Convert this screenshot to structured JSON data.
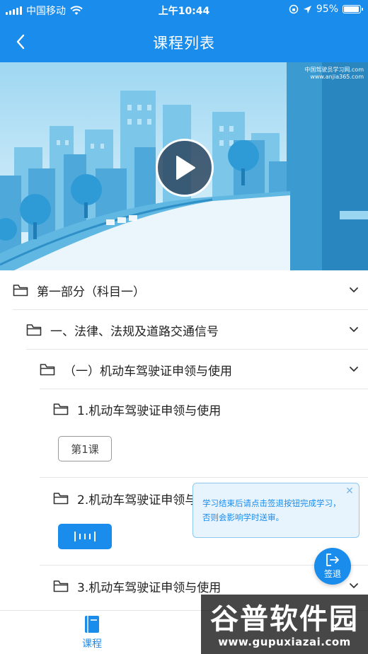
{
  "status_bar": {
    "carrier": "中国移动",
    "time": "上午10:44",
    "battery": "95%",
    "battery_level": 0.95
  },
  "nav": {
    "title": "课程列表",
    "back_icon": "chevron-left-icon"
  },
  "video": {
    "watermark_line1": "中国驾驶员学习网.com",
    "watermark_line2": "www.anjia365.com",
    "play_icon": "play-icon"
  },
  "tree": {
    "part": "第一部分（科目一）",
    "chapter": "一、法律、法规及道路交通信号",
    "section": "（一）机动车驾驶证申领与使用",
    "items": [
      {
        "title": "1.机动车驾驶证申领与使用",
        "button": "第1课"
      },
      {
        "title": "2.机动车驾驶证申领与使用",
        "button_icon": "audio-wave-icon"
      },
      {
        "title": "3.机动车驾驶证申领与使用"
      }
    ]
  },
  "tooltip": {
    "line1": "学习结束后请点击签退按钮完成学习，",
    "line2": "否则会影响学时送审。",
    "close_icon": "close-icon"
  },
  "signout": {
    "label": "签退",
    "icon": "sign-out-icon"
  },
  "tab_bar": {
    "tabs": [
      {
        "label": "课程",
        "icon": "book-icon",
        "active": true
      }
    ]
  },
  "brand_watermark": {
    "title": "谷普软件园",
    "url": "www.gupuxiazai.com"
  },
  "colors": {
    "primary": "#1a8cec",
    "tip_bg": "#e8f4fd",
    "divider": "#e6e6e6"
  }
}
